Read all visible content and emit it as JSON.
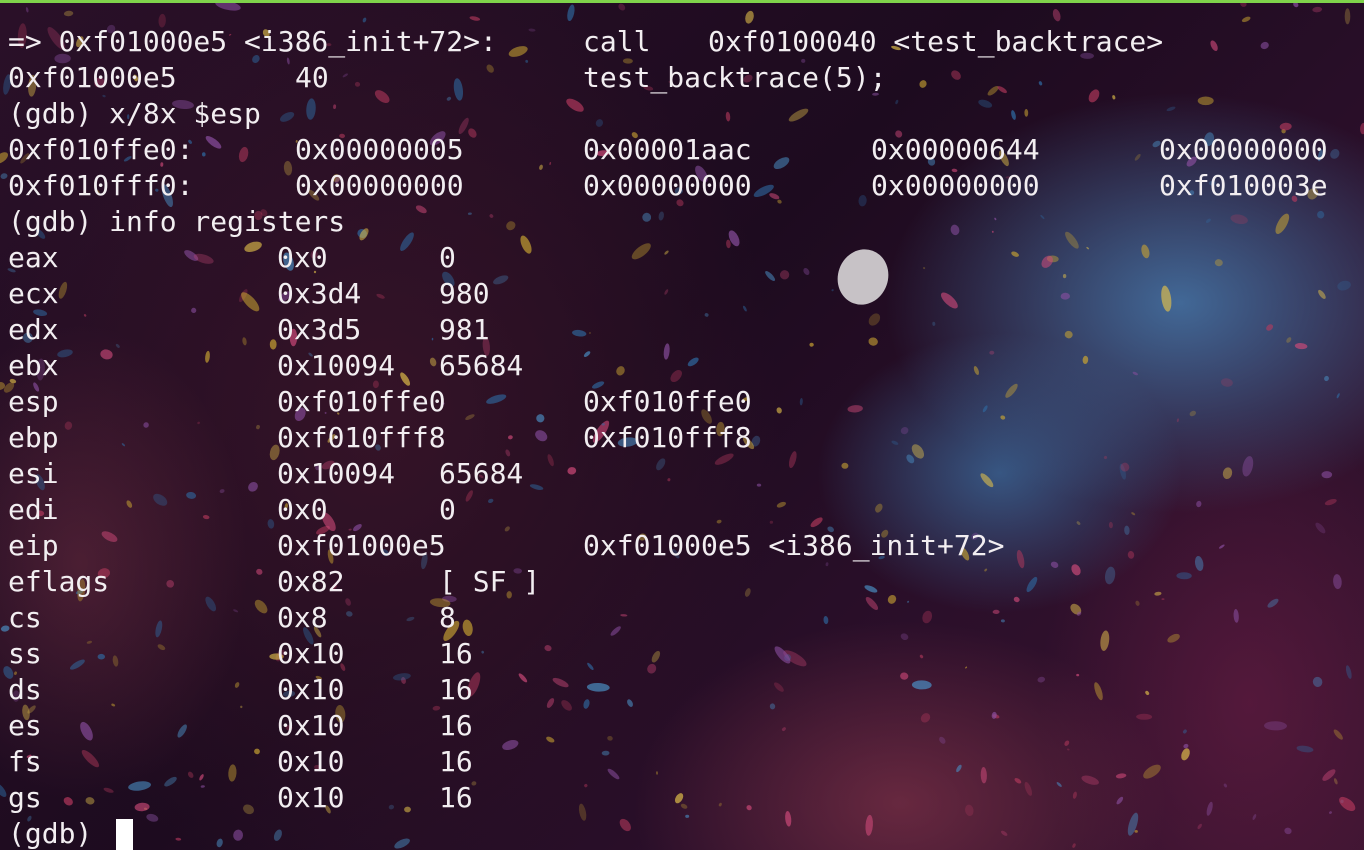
{
  "terminal": {
    "top_bar_color": "#7fd34b",
    "text_color": "#f2eef1",
    "lines": [
      {
        "kind": "asm",
        "cols": [
          "=> 0xf01000e5 <i386_init+72>:",
          "call",
          "0xf0100040 <test_backtrace>"
        ]
      },
      {
        "kind": "src",
        "cols": [
          "0xf01000e5",
          "40",
          "test_backtrace(5);"
        ]
      },
      {
        "kind": "prompt",
        "text": "(gdb) x/8x $esp"
      },
      {
        "kind": "mem",
        "cols": [
          "0xf010ffe0:",
          "0x00000005",
          "0x00001aac",
          "0x00000644",
          "0x00000000"
        ]
      },
      {
        "kind": "mem",
        "cols": [
          "0xf010fff0:",
          "0x00000000",
          "0x00000000",
          "0x00000000",
          "0xf010003e"
        ]
      },
      {
        "kind": "prompt",
        "text": "(gdb) info registers"
      },
      {
        "kind": "reg",
        "cols": [
          "eax",
          "0x0",
          "0"
        ]
      },
      {
        "kind": "reg",
        "cols": [
          "ecx",
          "0x3d4",
          "980"
        ]
      },
      {
        "kind": "reg",
        "cols": [
          "edx",
          "0x3d5",
          "981"
        ]
      },
      {
        "kind": "reg",
        "cols": [
          "ebx",
          "0x10094",
          "65684"
        ]
      },
      {
        "kind": "regwide",
        "cols": [
          "esp",
          "0xf010ffe0",
          "0xf010ffe0"
        ]
      },
      {
        "kind": "regwide",
        "cols": [
          "ebp",
          "0xf010fff8",
          "0xf010fff8"
        ]
      },
      {
        "kind": "reg",
        "cols": [
          "esi",
          "0x10094",
          "65684"
        ]
      },
      {
        "kind": "reg",
        "cols": [
          "edi",
          "0x0",
          "0"
        ]
      },
      {
        "kind": "regwide",
        "cols": [
          "eip",
          "0xf01000e5",
          "0xf01000e5 <i386_init+72>"
        ]
      },
      {
        "kind": "reg",
        "cols": [
          "eflags",
          "0x82",
          "[ SF ]"
        ]
      },
      {
        "kind": "reg",
        "cols": [
          "cs",
          "0x8",
          "8"
        ]
      },
      {
        "kind": "reg",
        "cols": [
          "ss",
          "0x10",
          "16"
        ]
      },
      {
        "kind": "reg",
        "cols": [
          "ds",
          "0x10",
          "16"
        ]
      },
      {
        "kind": "reg",
        "cols": [
          "es",
          "0x10",
          "16"
        ]
      },
      {
        "kind": "reg",
        "cols": [
          "fs",
          "0x10",
          "16"
        ]
      },
      {
        "kind": "reg",
        "cols": [
          "gs",
          "0x10",
          "16"
        ]
      },
      {
        "kind": "input",
        "text": "(gdb) "
      }
    ]
  }
}
